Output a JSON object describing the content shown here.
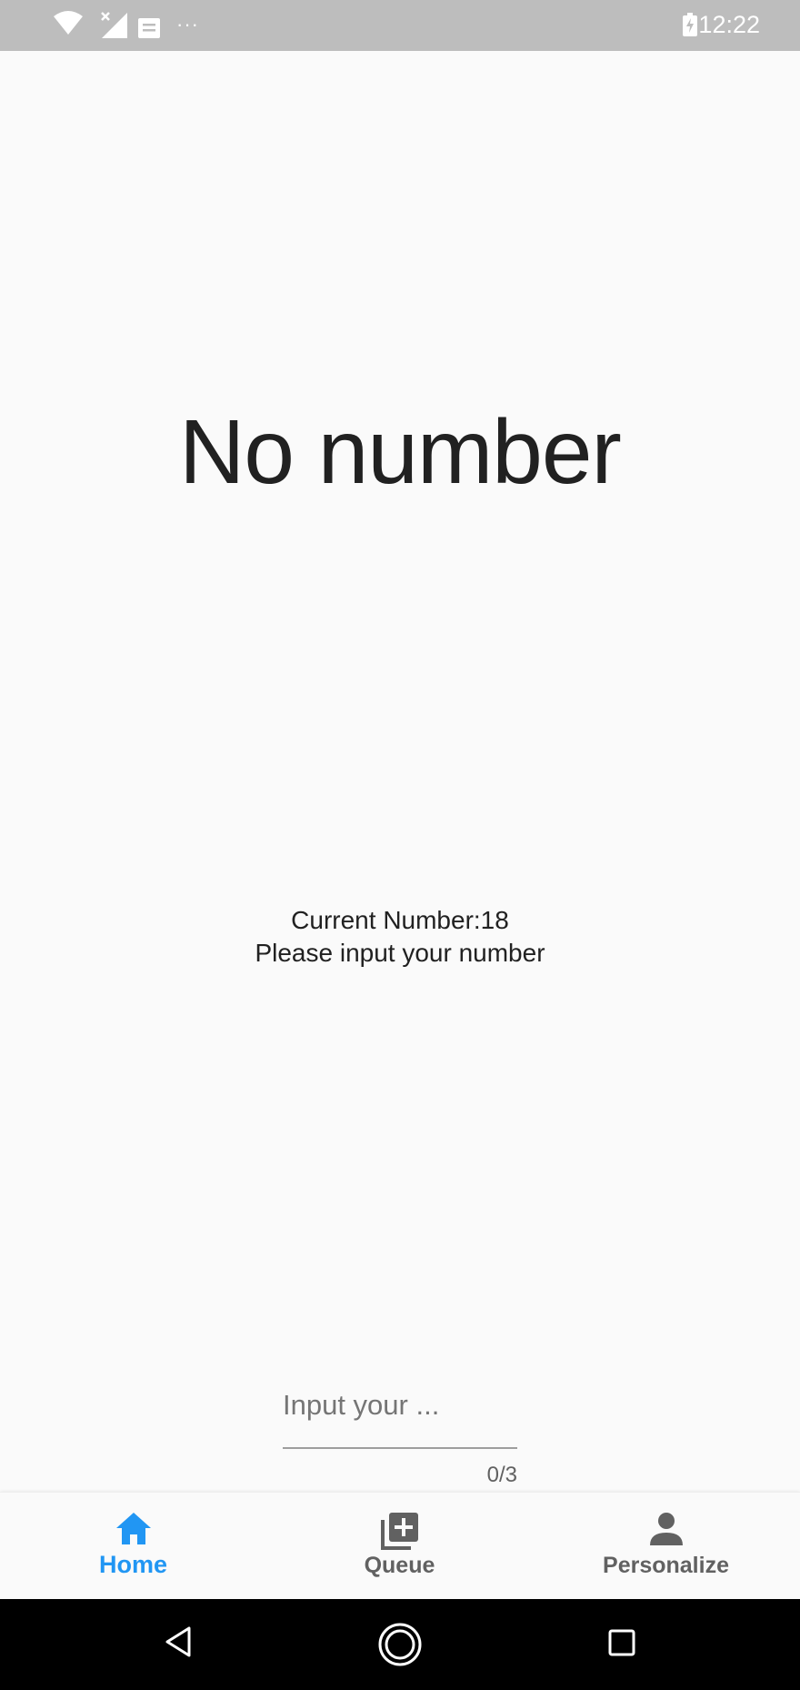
{
  "status_bar": {
    "time": "12:22",
    "more_dots": "···",
    "icons": [
      "wifi-icon",
      "signal-icon",
      "message-icon",
      "battery-charging-icon"
    ]
  },
  "main": {
    "headline": "No number",
    "current_number_text": "Current Number:18",
    "instruction_text": "Please input your number"
  },
  "input": {
    "placeholder": "Input your ...",
    "value": "",
    "counter": "0/3"
  },
  "bottom_nav": {
    "items": [
      {
        "label": "Home",
        "icon": "home-icon",
        "active": true
      },
      {
        "label": "Queue",
        "icon": "queue-add-icon",
        "active": false
      },
      {
        "label": "Personalize",
        "icon": "person-icon",
        "active": false
      }
    ],
    "active_color": "#2196f3",
    "inactive_color": "#616161"
  },
  "colors": {
    "status_bar_bg": "#bdbdbd",
    "background": "#fafafa",
    "text_primary": "#212121"
  }
}
